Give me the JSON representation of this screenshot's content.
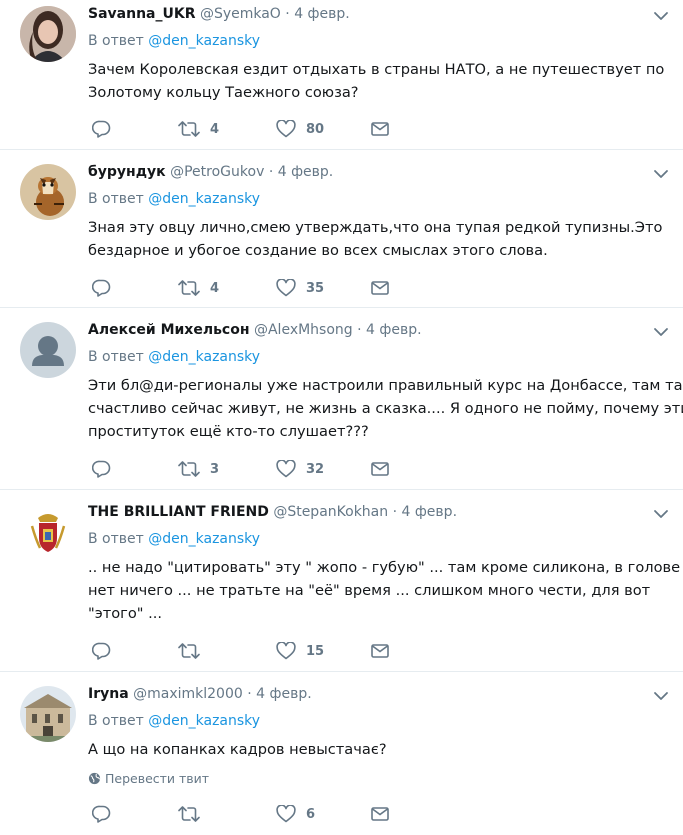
{
  "reply_prefix": "В ответ",
  "tweets": [
    {
      "name": "Savanna_UKR",
      "handle": "@SyemkaO",
      "sep": "·",
      "date": "4 февр.",
      "reply_mention": "@den_kazansky",
      "text_lines": [
        "Зачем Королевская ездит отдыхать в страны НАТО, а не путешествует по",
        "Золотому кольцу Таежного союза?"
      ],
      "retweets": "4",
      "likes": "80",
      "avatar_icon": "woman-photo"
    },
    {
      "name": "бурундук",
      "handle": "@PetroGukov",
      "sep": "·",
      "date": "4 февр.",
      "reply_mention": "@den_kazansky",
      "text_lines": [
        "Зная эту овцу лично,смею утверждать,что она тупая  редкой тупизны.Это",
        "бездарное и убогое создание во всех смыслах этого слова."
      ],
      "retweets": "4",
      "likes": "35",
      "avatar_icon": "chipmunk-photo"
    },
    {
      "name": "Алексей Михельсон",
      "handle": "@AlexMhsong",
      "sep": "·",
      "date": "4 февр.",
      "reply_mention": "@den_kazansky",
      "text_lines": [
        "Эти бл@ди-регионалы уже настроили правильный курс на Донбассе, там так",
        "счастливо сейчас живут, не жизнь а сказка.... Я одного не пойму, почему этих",
        "проституток ещё кто-то слушает???"
      ],
      "retweets": "3",
      "likes": "32",
      "avatar_icon": "default-avatar"
    },
    {
      "name": "THE BRILLIANT FRIEND",
      "handle": "@StepanKokhan",
      "sep": "·",
      "date": "4 февр.",
      "reply_mention": "@den_kazansky",
      "text_lines": [
        ".. не надо \"цитировать\" эту \" жопо - губую\" ... там кроме силикона, в голове",
        "нет ничего ... не тратьте на \"её\" время ... слишком много чести, для вот",
        "\"этого\" ..."
      ],
      "retweets": "",
      "likes": "15",
      "avatar_icon": "coat-of-arms"
    },
    {
      "name": "Iryna",
      "handle": "@maximkl2000",
      "sep": "·",
      "date": "4 февр.",
      "reply_mention": "@den_kazansky",
      "text_lines": [
        "А що на копанках кадров невыстачає?"
      ],
      "translate_label": "Перевести твит",
      "retweets": "",
      "likes": "6",
      "avatar_icon": "building-photo"
    }
  ],
  "colors": {
    "text": "#14171a",
    "secondary": "#657786",
    "link": "#1b95e0",
    "divider": "#e6ecf0"
  }
}
